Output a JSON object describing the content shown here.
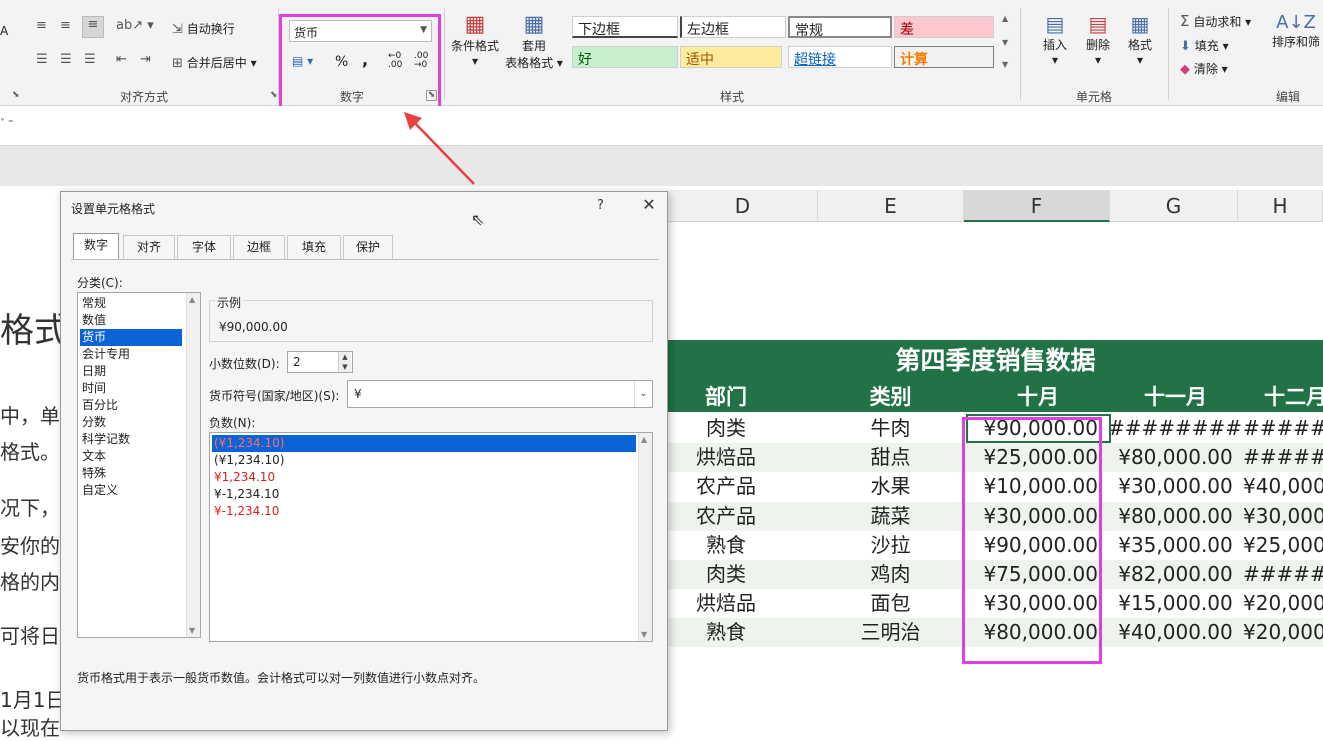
{
  "ribbon": {
    "wrap_text": "自动换行",
    "merge_center": "合并后居中",
    "align_group": "对齐方式",
    "number_format_value": "货币",
    "percent": "%",
    "comma": ",",
    "inc_decimal": "←.0\n.00",
    "dec_decimal": ".00\n→.0",
    "number_group": "数字",
    "cond_format": "条件格式",
    "table_format_1": "套用",
    "table_format_2": "表格格式",
    "styles": {
      "s1": "下边框",
      "s2": "左边框",
      "s3": "常规",
      "s4": "差",
      "s5": "好",
      "s6": "适中",
      "s7": "超链接",
      "s8": "计算"
    },
    "styles_group": "样式",
    "insert": "插入",
    "delete": "删除",
    "format": "格式",
    "cells_group": "单元格",
    "autosum": "自动求和",
    "fill": "填充",
    "clear": "清除",
    "sort_filter": "排序和筛",
    "edit_group": "编辑",
    "left_a": "A",
    "colors": {
      "green": "#217346",
      "magenta": "#e040e0",
      "good_bg": "#c6efce",
      "bad_bg": "#ffc7ce",
      "neutral_bg": "#ffeb9c"
    }
  },
  "columns": [
    "D",
    "E",
    "F",
    "G",
    "H"
  ],
  "doc": {
    "lines": [
      "格式",
      "中，单",
      "格式。忄",
      "况下，",
      "安你的",
      "格的内",
      "可将日",
      "1月1日",
      "以现在"
    ]
  },
  "sheet": {
    "title": "第四季度销售数据",
    "headers": [
      "部门",
      "类别",
      "十月",
      "十一月",
      "十二月"
    ],
    "rows": [
      {
        "dept": "肉类",
        "cat": "牛肉",
        "oct": "¥90,000.00",
        "nov": "#########",
        "dec": "######"
      },
      {
        "dept": "烘焙品",
        "cat": "甜点",
        "oct": "¥25,000.00",
        "nov": "¥80,000.00",
        "dec": "######"
      },
      {
        "dept": "农产品",
        "cat": "水果",
        "oct": "¥10,000.00",
        "nov": "¥30,000.00",
        "dec": "¥40,000."
      },
      {
        "dept": "农产品",
        "cat": "蔬菜",
        "oct": "¥30,000.00",
        "nov": "¥80,000.00",
        "dec": "¥30,000."
      },
      {
        "dept": "熟食",
        "cat": "沙拉",
        "oct": "¥90,000.00",
        "nov": "¥35,000.00",
        "dec": "¥25,000."
      },
      {
        "dept": "肉类",
        "cat": "鸡肉",
        "oct": "¥75,000.00",
        "nov": "¥82,000.00",
        "dec": "######"
      },
      {
        "dept": "烘焙品",
        "cat": "面包",
        "oct": "¥30,000.00",
        "nov": "¥15,000.00",
        "dec": "¥20,000."
      },
      {
        "dept": "熟食",
        "cat": "三明治",
        "oct": "¥80,000.00",
        "nov": "¥40,000.00",
        "dec": "¥20,000."
      }
    ]
  },
  "dialog": {
    "title": "设置单元格格式",
    "help": "?",
    "close": "✕",
    "tabs": [
      "数字",
      "对齐",
      "字体",
      "边框",
      "填充",
      "保护"
    ],
    "category_label": "分类(C):",
    "categories": [
      "常规",
      "数值",
      "货币",
      "会计专用",
      "日期",
      "时间",
      "百分比",
      "分数",
      "科学记数",
      "文本",
      "特殊",
      "自定义"
    ],
    "selected_category": "货币",
    "sample_label": "示例",
    "sample_value": "¥90,000.00",
    "decimals_label": "小数位数(D):",
    "decimals_value": "2",
    "currency_symbol_label": "货币符号(国家/地区)(S):",
    "currency_symbol_value": "¥",
    "negative_label": "负数(N):",
    "negatives": [
      "(¥1,234.10)",
      "(¥1,234.10)",
      "¥1,234.10",
      "¥-1,234.10",
      "¥-1,234.10"
    ],
    "description": "货币格式用于表示一般货币数值。会计格式可以对一列数值进行小数点对齐。"
  }
}
